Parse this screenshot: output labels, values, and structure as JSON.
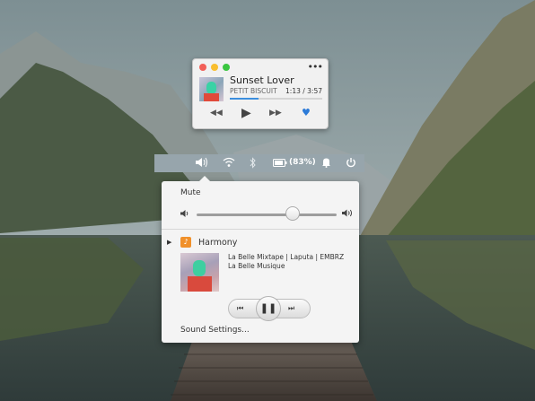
{
  "mini_player": {
    "title": "Sunset Lover",
    "artist": "PETIT BISCUIT",
    "time": "1:13 / 3:57",
    "progress_fraction": 0.31,
    "more_label": "•••",
    "prev_symbol": "◀◀",
    "play_symbol": "▶",
    "next_symbol": "▶▶",
    "heart_symbol": "♥"
  },
  "panel": {
    "battery_text": "(83%)",
    "icons": [
      "volume-icon",
      "wifi-icon",
      "bluetooth-icon",
      "battery-icon",
      "notification-bell-icon",
      "power-icon"
    ]
  },
  "sound_menu": {
    "mute_label": "Mute",
    "volume_fraction": 0.68,
    "player_name": "Harmony",
    "player_icon_glyph": "♪",
    "expand_symbol": "▶",
    "track_title": "La Belle Mixtape | Laputa | EMBRZ",
    "track_album": "La Belle Musique",
    "prev_symbol": "⏮",
    "pause_symbol": "❚❚",
    "next_symbol": "⏭",
    "settings_label": "Sound Settings..."
  },
  "colors": {
    "accent": "#3b8ede",
    "panel": "#97a5ac",
    "popover": "#f4f4f4"
  }
}
